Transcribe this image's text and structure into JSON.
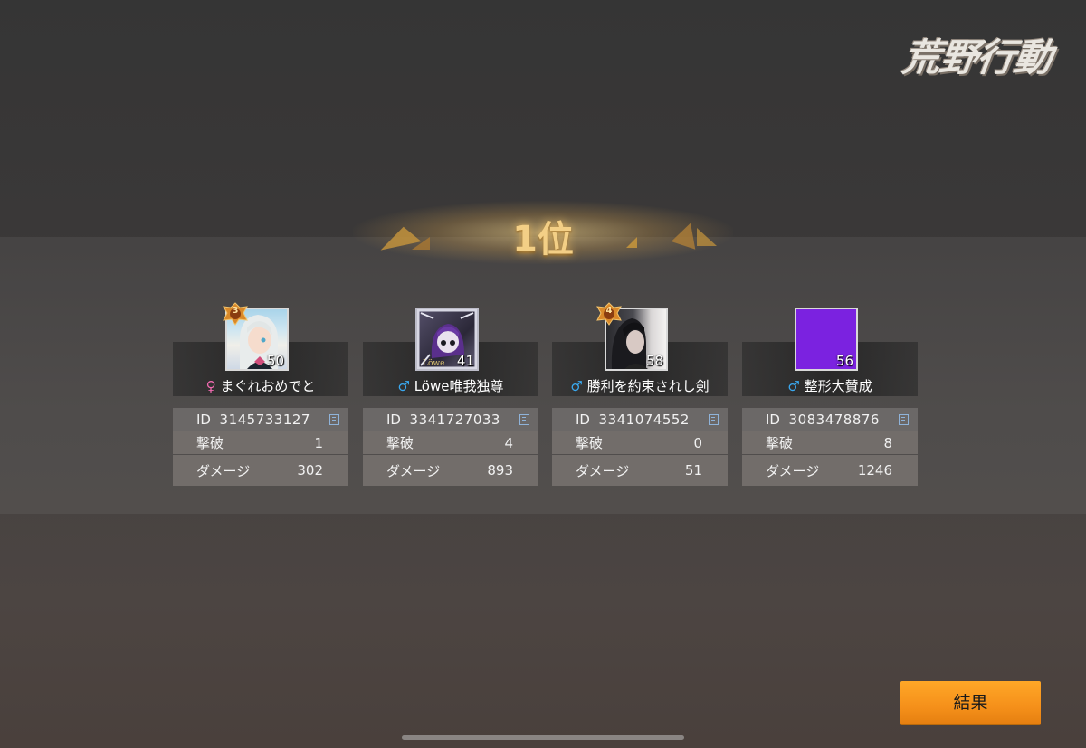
{
  "logo": "荒野行動",
  "rank": "1位",
  "players": [
    {
      "gender_symbol": "♀",
      "gender": "female",
      "name": "まぐれおめでと",
      "level": "50",
      "badge": "3",
      "id_label": "ID",
      "id": "3145733127",
      "kills_label": "撃破",
      "kills": "1",
      "damage_label": "ダメージ",
      "damage": "302"
    },
    {
      "gender_symbol": "♂",
      "gender": "male",
      "name": "Löwe唯我独尊",
      "level": "41",
      "badge": "",
      "id_label": "ID",
      "id": "3341727033",
      "kills_label": "撃破",
      "kills": "4",
      "damage_label": "ダメージ",
      "damage": "893"
    },
    {
      "gender_symbol": "♂",
      "gender": "male",
      "name": "勝利を約束されし剣",
      "level": "58",
      "badge": "4",
      "id_label": "ID",
      "id": "3341074552",
      "kills_label": "撃破",
      "kills": "0",
      "damage_label": "ダメージ",
      "damage": "51"
    },
    {
      "gender_symbol": "♂",
      "gender": "male",
      "name": "整形大賛成",
      "level": "56",
      "badge": "",
      "id_label": "ID",
      "id": "3083478876",
      "kills_label": "撃破",
      "kills": "8",
      "damage_label": "ダメージ",
      "damage": "1246"
    }
  ],
  "result_button": "結果",
  "colors": {
    "accent_orange": "#f5901a",
    "male": "#3aa9f0",
    "female": "#f06ab0",
    "rank_gold": "#f3cf86"
  }
}
